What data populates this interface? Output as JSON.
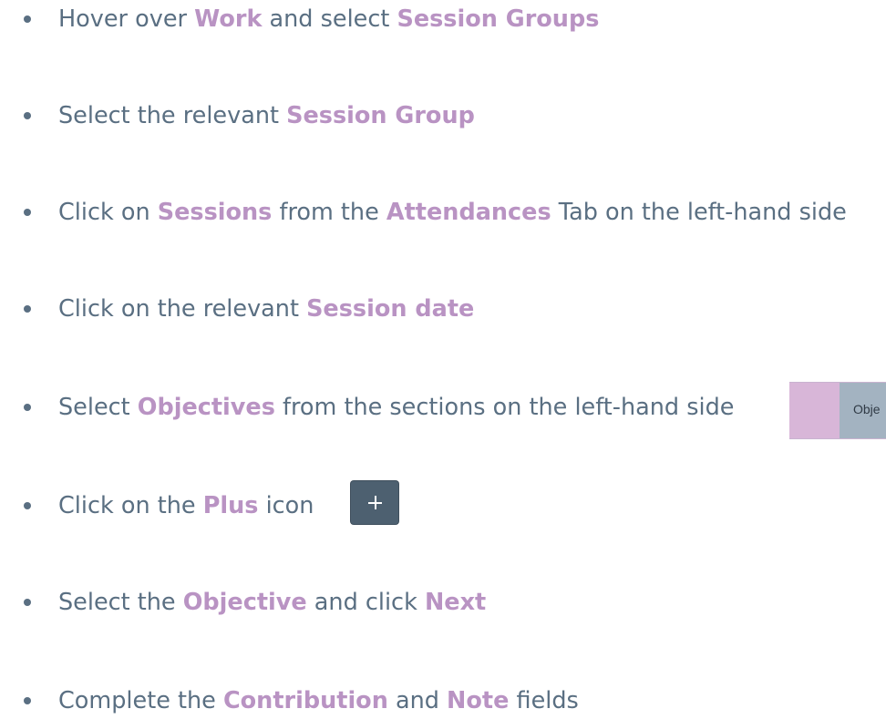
{
  "steps": [
    {
      "parts": [
        {
          "text": "Hover over ",
          "em": false
        },
        {
          "text": "Work",
          "em": true
        },
        {
          "text": " and select ",
          "em": false
        },
        {
          "text": "Session Groups",
          "em": true
        }
      ]
    },
    {
      "parts": [
        {
          "text": "Select the relevant ",
          "em": false
        },
        {
          "text": "Session Group",
          "em": true
        }
      ]
    },
    {
      "parts": [
        {
          "text": "Click on ",
          "em": false
        },
        {
          "text": "Sessions",
          "em": true
        },
        {
          "text": " from the ",
          "em": false
        },
        {
          "text": "Attendances",
          "em": true
        },
        {
          "text": " Tab on the left-hand side",
          "em": false
        }
      ]
    },
    {
      "parts": [
        {
          "text": "Click on the relevant ",
          "em": false
        },
        {
          "text": "Session date",
          "em": true
        }
      ]
    },
    {
      "parts": [
        {
          "text": "Select ",
          "em": false
        },
        {
          "text": "Objectives",
          "em": true
        },
        {
          "text": " from the sections on the left-hand side",
          "em": false
        }
      ]
    },
    {
      "parts": [
        {
          "text": "Click on the ",
          "em": false
        },
        {
          "text": "Plus",
          "em": true
        },
        {
          "text": " icon",
          "em": false
        }
      ]
    },
    {
      "parts": [
        {
          "text": "Select the ",
          "em": false
        },
        {
          "text": "Objective",
          "em": true
        },
        {
          "text": " and click ",
          "em": false
        },
        {
          "text": "Next",
          "em": true
        }
      ]
    },
    {
      "parts": [
        {
          "text": "Complete the ",
          "em": false
        },
        {
          "text": "Contribution",
          "em": true
        },
        {
          "text": " and ",
          "em": false
        },
        {
          "text": "Note",
          "em": true
        },
        {
          "text": " fields",
          "em": false
        }
      ]
    }
  ],
  "objectives_snippet": {
    "label": "Obje"
  },
  "colors": {
    "text": "#5a6f82",
    "emphasis": "#b993c3",
    "plus_button": "#4d6070"
  },
  "icons": {
    "plus_button": "plus-icon"
  }
}
